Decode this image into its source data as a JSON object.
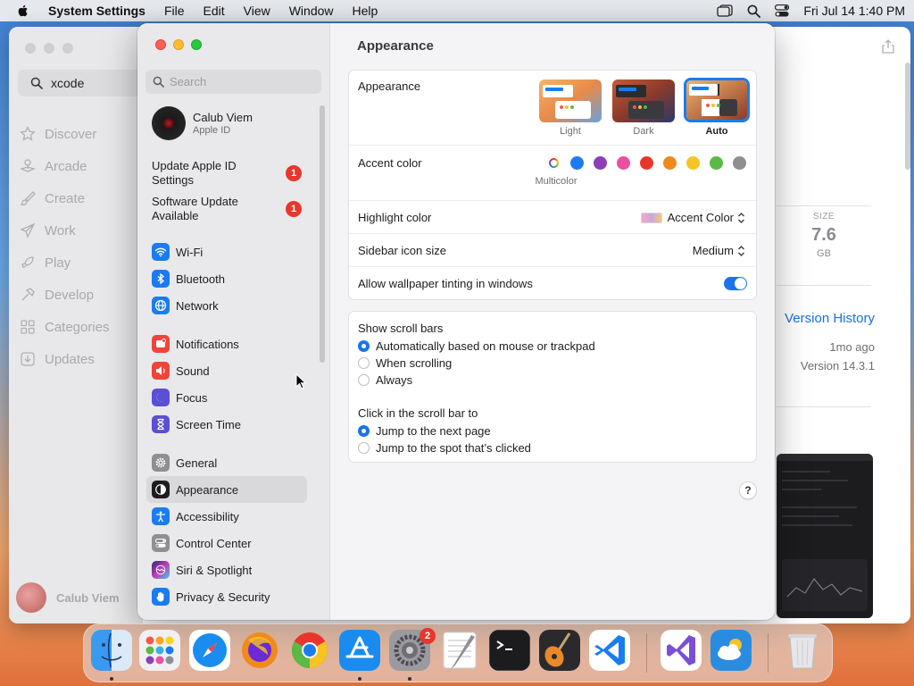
{
  "menubar": {
    "app_name": "System Settings",
    "menus": [
      "File",
      "Edit",
      "View",
      "Window",
      "Help"
    ],
    "clock": "Fri Jul 14  1:40 PM"
  },
  "appstore": {
    "search_value": "xcode",
    "nav": [
      "Discover",
      "Arcade",
      "Create",
      "Work",
      "Play",
      "Develop",
      "Categories",
      "Updates"
    ],
    "user_name": "Calub Viem",
    "size_label": "SIZE",
    "size_value": "7.6",
    "size_unit": "GB",
    "version_history": "Version History",
    "updated_ago": "1mo ago",
    "version": "Version 14.3.1"
  },
  "sidebar": {
    "search_placeholder": "Search",
    "user_name": "Calub Viem",
    "user_sub": "Apple ID",
    "updates": [
      {
        "label": "Update Apple ID Settings",
        "badge": "1"
      },
      {
        "label": "Software Update Available",
        "badge": "1"
      }
    ],
    "group1": [
      {
        "label": "Wi-Fi",
        "icon": "wifi-icon",
        "color": "#1a7cf0"
      },
      {
        "label": "Bluetooth",
        "icon": "bluetooth-icon",
        "color": "#1a7cf0"
      },
      {
        "label": "Network",
        "icon": "globe-icon",
        "color": "#1a7cf0"
      }
    ],
    "group2": [
      {
        "label": "Notifications",
        "icon": "bell-icon",
        "color": "#f0443b"
      },
      {
        "label": "Sound",
        "icon": "speaker-icon",
        "color": "#f0443b"
      },
      {
        "label": "Focus",
        "icon": "moon-icon",
        "color": "#5b4fd6"
      },
      {
        "label": "Screen Time",
        "icon": "hourglass-icon",
        "color": "#5b4fd6"
      }
    ],
    "group3": [
      {
        "label": "General",
        "icon": "gear-icon",
        "color": "#8e8e93"
      },
      {
        "label": "Appearance",
        "icon": "appearance-icon",
        "color": "#1d1d1f"
      },
      {
        "label": "Accessibility",
        "icon": "accessibility-icon",
        "color": "#1a7cf0"
      },
      {
        "label": "Control Center",
        "icon": "switches-icon",
        "color": "#8e8e93"
      },
      {
        "label": "Siri & Spotlight",
        "icon": "siri-icon",
        "color": "#7a3fd6"
      },
      {
        "label": "Privacy & Security",
        "icon": "hand-icon",
        "color": "#1a7cf0"
      }
    ]
  },
  "content": {
    "title": "Appearance",
    "appearance_label": "Appearance",
    "modes": [
      "Light",
      "Dark",
      "Auto"
    ],
    "selected_mode": "Auto",
    "accent_label": "Accent color",
    "accent_selected_name": "Multicolor",
    "accent_colors": [
      "#1a7cf0",
      "#8a3fb8",
      "#eb4fa0",
      "#e8362d",
      "#f0891b",
      "#f7c325",
      "#5ab947",
      "#8e8e93"
    ],
    "highlight_label": "Highlight color",
    "highlight_value": "Accent Color",
    "sidebar_icon_label": "Sidebar icon size",
    "sidebar_icon_value": "Medium",
    "tinting_label": "Allow wallpaper tinting in windows",
    "tinting_on": true,
    "scrollbars_label": "Show scroll bars",
    "scrollbar_options": [
      "Automatically based on mouse or trackpad",
      "When scrolling",
      "Always"
    ],
    "click_label": "Click in the scroll bar to",
    "click_options": [
      "Jump to the next page",
      "Jump to the spot that’s clicked"
    ],
    "help": "?"
  },
  "dock": {
    "settings_badge": "2"
  }
}
